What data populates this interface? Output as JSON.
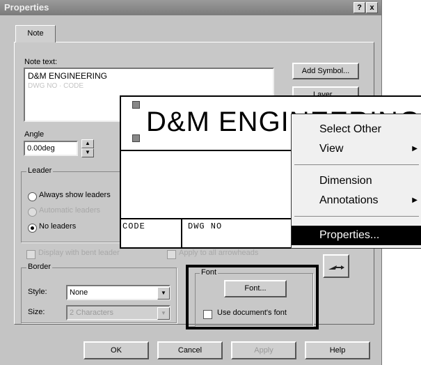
{
  "dialog": {
    "title": "Properties",
    "title_buttons": [
      "?",
      "x"
    ],
    "tab": "Note",
    "note_text_label": "Note text:",
    "note_text_line1": "D&M ENGINEERING",
    "note_text_line2": "DWG NO · CODE",
    "add_symbol_button": "Add Symbol...",
    "layer_button": "Layer...",
    "angle_label": "Angle",
    "angle_value": "0.00deg",
    "leader": {
      "label": "Leader",
      "options": [
        "Always show leaders",
        "Automatic leaders",
        "No leaders"
      ],
      "selected": "No leaders",
      "display_bent": "Display with bent leader",
      "apply_all": "Apply to all arrowheads"
    },
    "border": {
      "label": "Border",
      "style_label": "Style:",
      "style_value": "None",
      "size_label": "Size:",
      "size_value": "2 Characters"
    },
    "font": {
      "label": "Font",
      "font_button": "Font...",
      "use_doc_font": "Use document's font"
    },
    "buttons": {
      "ok": "OK",
      "cancel": "Cancel",
      "apply": "Apply",
      "help": "Help"
    }
  },
  "preview": {
    "title": "D&M ENGINEERING",
    "code_label": "CODE",
    "dwg_label": "DWG NO"
  },
  "context_menu": {
    "items": [
      {
        "label": "Select Other",
        "submenu": false
      },
      {
        "label": "View",
        "submenu": true
      },
      {
        "label": "Dimension",
        "submenu": false
      },
      {
        "label": "Annotations",
        "submenu": true
      },
      {
        "label": "Properties...",
        "submenu": false,
        "selected": true
      }
    ]
  },
  "icons": {
    "question": "?",
    "close": "x",
    "spin_up": "▲",
    "spin_down": "▼",
    "dropdown": "▼",
    "submenu_arrow": "▶"
  }
}
